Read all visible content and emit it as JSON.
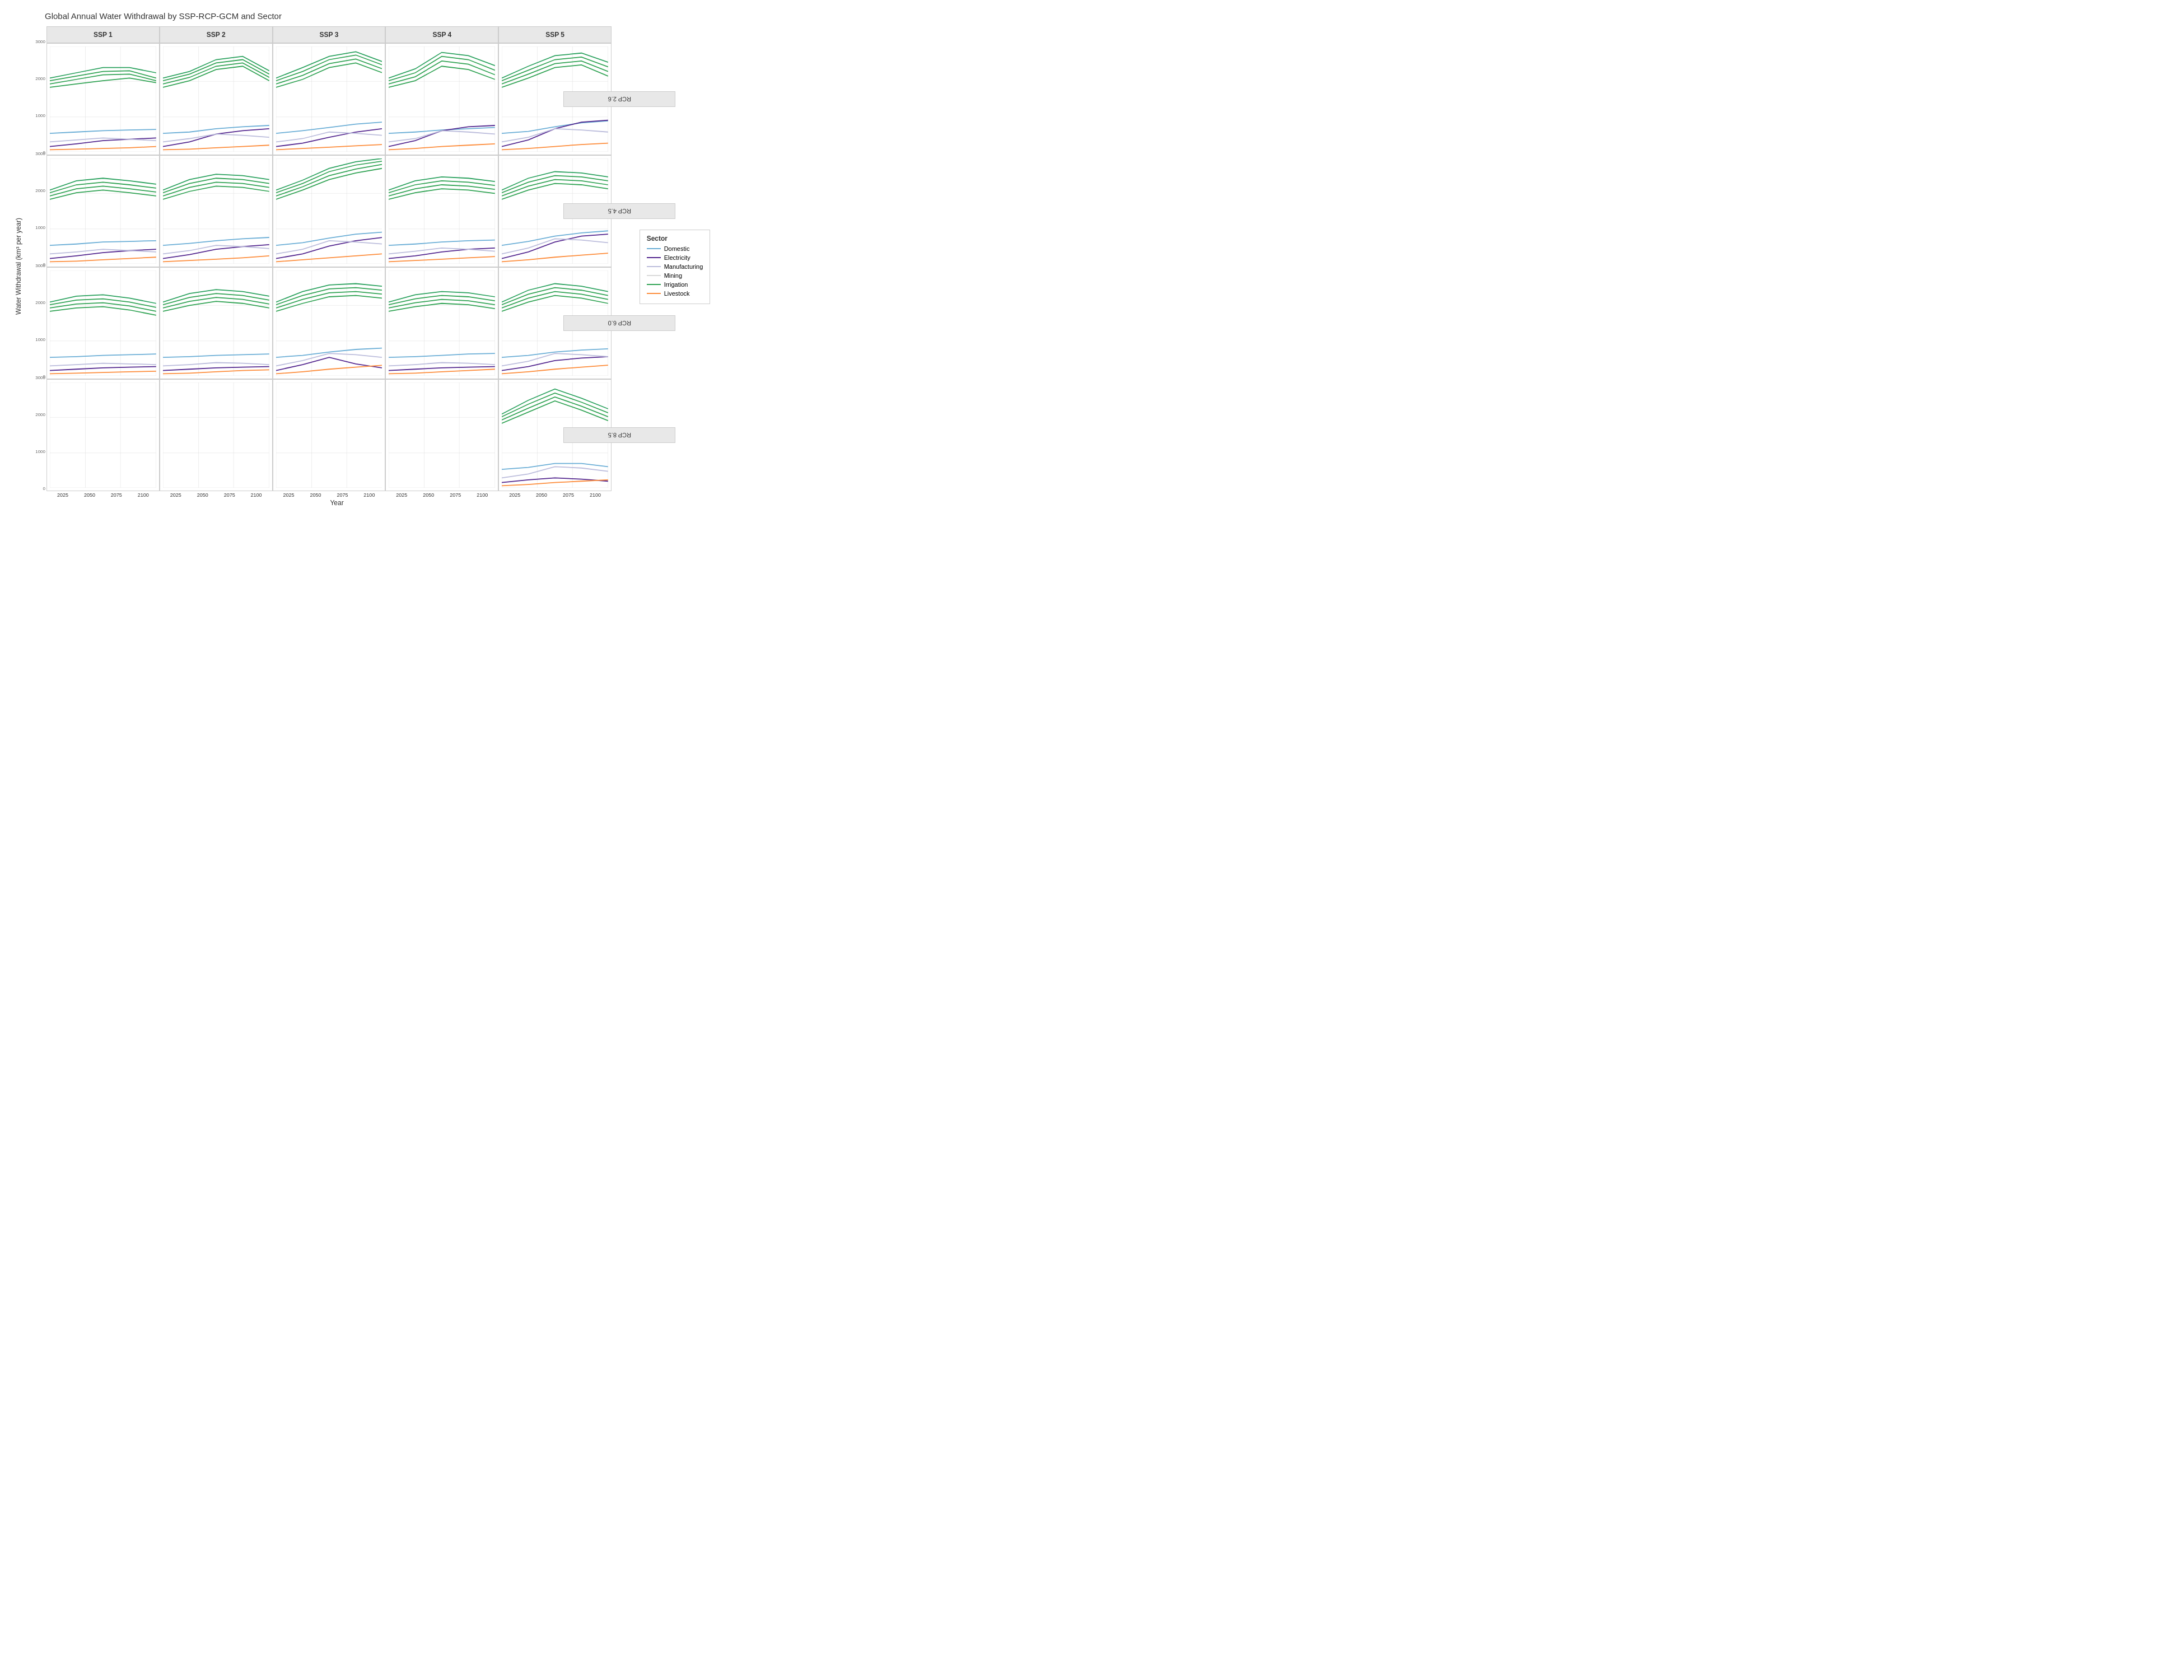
{
  "title": "Global Annual Water Withdrawal by SSP-RCP-GCM and Sector",
  "xAxisLabel": "Year",
  "yAxisLabel": "Water Withdrawal (km³ per year)",
  "colHeaders": [
    "SSP 1",
    "SSP 2",
    "SSP 3",
    "SSP 4",
    "SSP 5"
  ],
  "rowHeaders": [
    "RCP 2.6",
    "RCP 4.5",
    "RCP 6.0",
    "RCP 8.5"
  ],
  "xTicks": [
    "2025",
    "2050",
    "2075",
    "2100"
  ],
  "yTicks": [
    "0",
    "1000",
    "2000",
    "3000"
  ],
  "legend": {
    "title": "Sector",
    "items": [
      {
        "label": "Domestic",
        "color": "#6baed6"
      },
      {
        "label": "Electricity",
        "color": "#54278f"
      },
      {
        "label": "Manufacturing",
        "color": "#bcbddc"
      },
      {
        "label": "Mining",
        "color": "#d9d9d9"
      },
      {
        "label": "Irrigation",
        "color": "#31a354"
      },
      {
        "label": "Livestock",
        "color": "#fd8d3c"
      }
    ]
  },
  "panels": {
    "r0c0": {
      "irrigation": [
        [
          0,
          1850
        ],
        [
          25,
          1950
        ],
        [
          50,
          2100
        ],
        [
          75,
          2200
        ],
        [
          100,
          2250
        ]
      ],
      "irrigation2": [
        [
          0,
          1900
        ],
        [
          25,
          2050
        ],
        [
          50,
          2250
        ],
        [
          75,
          2350
        ],
        [
          100,
          2200
        ]
      ],
      "irrigation3": [
        [
          0,
          1950
        ],
        [
          25,
          2100
        ],
        [
          50,
          2350
        ],
        [
          75,
          2350
        ],
        [
          100,
          2050
        ]
      ],
      "domestic": [
        [
          0,
          520
        ],
        [
          25,
          550
        ],
        [
          50,
          580
        ],
        [
          75,
          610
        ],
        [
          100,
          620
        ]
      ],
      "electricity": [
        [
          0,
          150
        ],
        [
          25,
          200
        ],
        [
          50,
          250
        ],
        [
          75,
          280
        ],
        [
          100,
          300
        ]
      ],
      "manufacturing": [
        [
          0,
          280
        ],
        [
          25,
          300
        ],
        [
          50,
          320
        ],
        [
          75,
          300
        ],
        [
          100,
          280
        ]
      ],
      "livestock": [
        [
          0,
          80
        ],
        [
          25,
          90
        ],
        [
          50,
          100
        ],
        [
          75,
          110
        ],
        [
          100,
          120
        ]
      ]
    },
    "r0c1": {
      "active": true
    },
    "r0c2": {
      "active": true
    },
    "r0c3": {
      "active": true
    },
    "r0c4": {
      "active": true
    },
    "r1c0": {
      "active": true
    },
    "r1c1": {
      "active": true
    },
    "r1c2": {
      "active": true
    },
    "r1c3": {
      "active": true
    },
    "r1c4": {
      "active": true
    },
    "r2c0": {
      "active": true
    },
    "r2c1": {
      "active": true
    },
    "r2c2": {
      "active": true
    },
    "r2c3": {
      "active": true
    },
    "r2c4": {
      "active": true
    },
    "r3c0": {
      "active": false
    },
    "r3c1": {
      "active": false
    },
    "r3c2": {
      "active": false
    },
    "r3c3": {
      "active": false
    },
    "r3c4": {
      "active": true
    }
  }
}
